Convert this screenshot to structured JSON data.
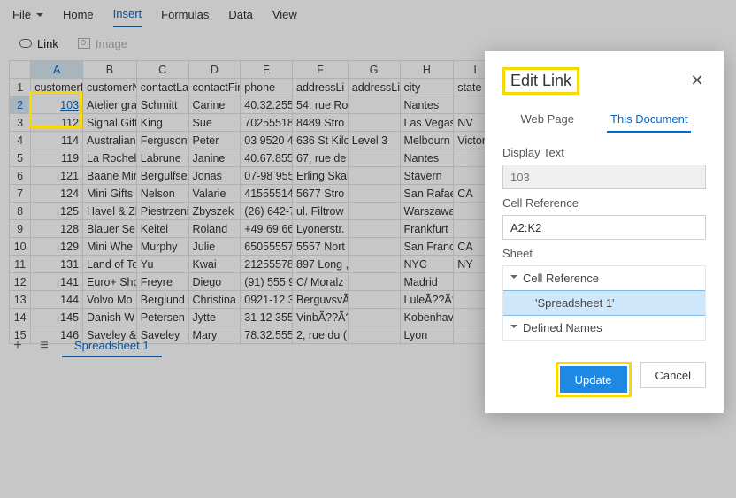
{
  "ribbon": {
    "file": "File",
    "home": "Home",
    "insert": "Insert",
    "formulas": "Formulas",
    "data": "Data",
    "view": "View"
  },
  "toolbar": {
    "link": "Link",
    "image": "Image"
  },
  "columns": [
    "A",
    "B",
    "C",
    "D",
    "E",
    "F",
    "G",
    "H",
    "I"
  ],
  "headers": [
    "customerI",
    "customerN",
    "contactLa",
    "contactFir",
    "phone",
    "addressLi",
    "addressLi",
    "city",
    "state"
  ],
  "rows": [
    {
      "n": "2",
      "c": [
        "103",
        "Atelier gra",
        "Schmitt",
        "Carine",
        "40.32.255",
        "54, rue Ro",
        "",
        "Nantes",
        ""
      ]
    },
    {
      "n": "3",
      "c": [
        "112",
        "Signal Gift",
        "King",
        "Sue",
        "70255518",
        "8489 Stro",
        "",
        "Las Vegas",
        "NV"
      ]
    },
    {
      "n": "4",
      "c": [
        "114",
        "Australian",
        "Ferguson",
        "Peter",
        "03 9520 4",
        "636 St Kilc",
        "Level 3",
        "Melbourn",
        "Victoria"
      ]
    },
    {
      "n": "5",
      "c": [
        "119",
        "La Rochell",
        "Labrune",
        "Janine",
        "40.67.855",
        "67, rue de",
        "",
        "Nantes",
        ""
      ]
    },
    {
      "n": "6",
      "c": [
        "121",
        "Baane Min",
        "Bergulfser",
        "Jonas",
        "07-98 955",
        "Erling Skal",
        "",
        "Stavern",
        ""
      ]
    },
    {
      "n": "7",
      "c": [
        "124",
        "Mini Gifts",
        "Nelson",
        "Valarie",
        "41555514",
        "5677 Stro",
        "",
        "San Rafae",
        "CA"
      ]
    },
    {
      "n": "8",
      "c": [
        "125",
        "Havel & Zl",
        "Piestrzeni",
        "Zbyszek",
        "(26) 642-7",
        "ul. Filtrow",
        "",
        "Warszawa",
        ""
      ]
    },
    {
      "n": "9",
      "c": [
        "128",
        "Blauer Se",
        "Keitel",
        "Roland",
        "+49 69 66",
        "Lyonerstr.",
        "",
        "Frankfurt",
        ""
      ]
    },
    {
      "n": "10",
      "c": [
        "129",
        "Mini Whe",
        "Murphy",
        "Julie",
        "65055557",
        "5557 Nort",
        "",
        "San Franci",
        "CA"
      ]
    },
    {
      "n": "11",
      "c": [
        "131",
        "Land of To",
        "Yu",
        "Kwai",
        "21255578",
        "897 Long ,",
        "",
        "NYC",
        "NY"
      ]
    },
    {
      "n": "12",
      "c": [
        "141",
        "Euro+ Sho",
        "Freyre",
        "Diego",
        "(91) 555 9",
        "C/ Moralz",
        "",
        "Madrid",
        ""
      ]
    },
    {
      "n": "13",
      "c": [
        "144",
        "Volvo Mo",
        "Berglund",
        "Christina",
        "0921-12 3",
        "BerguvsvÃ",
        "",
        "LuleÃ??Ã?",
        ""
      ]
    },
    {
      "n": "14",
      "c": [
        "145",
        "Danish W",
        "Petersen",
        "Jytte",
        "31 12 355",
        "VinbÃ??Ã?",
        "",
        "Kobenhav",
        ""
      ]
    },
    {
      "n": "15",
      "c": [
        "146",
        "Saveley &",
        "Saveley",
        "Mary",
        "78.32.555",
        "2, rue du (",
        "",
        "Lyon",
        ""
      ]
    }
  ],
  "sheet_tab": "Spreadsheet 1",
  "dialog": {
    "title": "Edit Link",
    "tabs": {
      "web": "Web Page",
      "doc": "This Document"
    },
    "display_label": "Display Text",
    "display_value": "103",
    "cellref_label": "Cell Reference",
    "cellref_value": "A2:K2",
    "sheet_label": "Sheet",
    "tree": {
      "cellref": "Cell Reference",
      "sheet": "'Spreadsheet 1'",
      "defnames": "Defined Names"
    },
    "update": "Update",
    "cancel": "Cancel"
  }
}
